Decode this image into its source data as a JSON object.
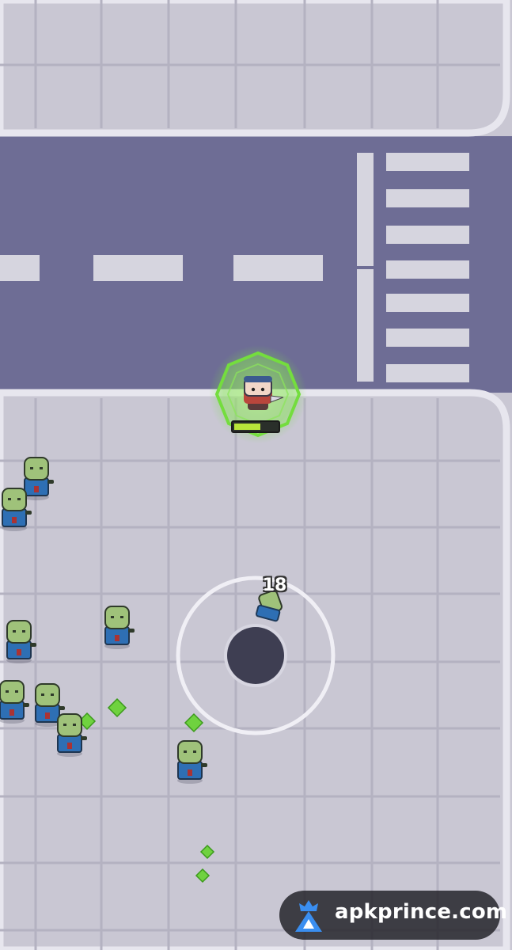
{
  "game": {
    "damage_number": "18",
    "player_health_fraction": 0.62
  },
  "watermark": {
    "text": "apkprince.com"
  },
  "colors": {
    "sidewalk": "#c9c7d3",
    "road": "#6e6d95",
    "curb": "#e6e5ec",
    "aura": "#6ad438",
    "gem": "#6fd23f",
    "zombie_skin": "#9fc27a",
    "zombie_shirt": "#2e6fb4"
  },
  "icons": [
    "player-character",
    "zombie-enemy",
    "experience-gem",
    "virtual-joystick"
  ]
}
